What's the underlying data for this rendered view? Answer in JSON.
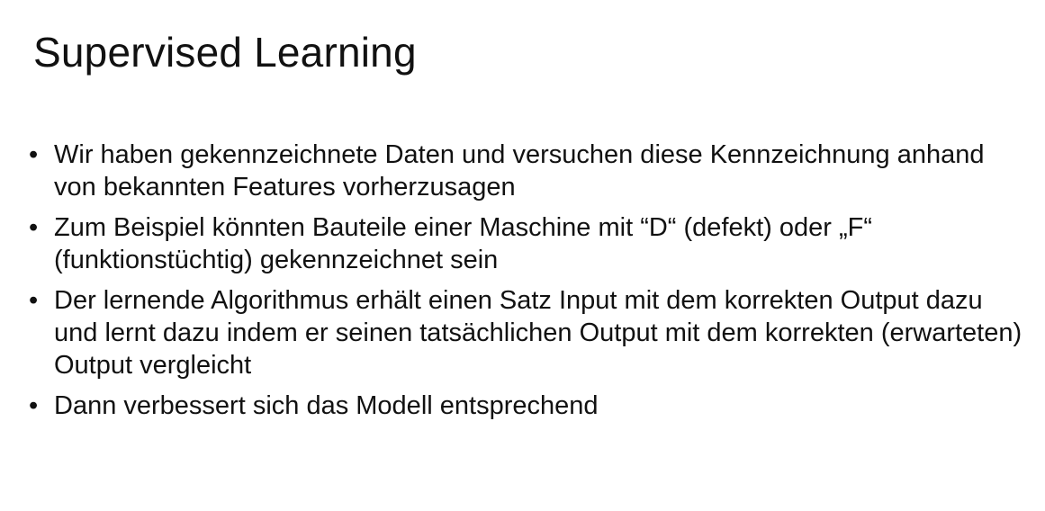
{
  "slide": {
    "title": "Supervised Learning",
    "bullets": [
      "Wir haben gekennzeichnete Daten und versuchen diese Kennzeichnung anhand von bekannten Features vorherzusagen",
      "Zum Beispiel könnten Bauteile einer Maschine mit “D“ (defekt) oder „F“ (funktionstüchtig) gekennzeichnet sein",
      "Der lernende Algorithmus erhält einen Satz Input mit dem korrekten Output dazu und lernt dazu indem er seinen tatsächlichen Output mit dem korrekten (erwarteten) Output vergleicht",
      "Dann verbessert sich das Modell entsprechend"
    ],
    "bullet_glyph": "•"
  }
}
